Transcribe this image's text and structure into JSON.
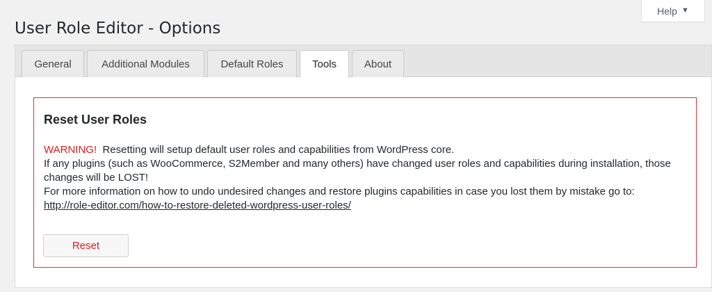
{
  "help_tab": {
    "label": "Help",
    "arrow": "▼",
    "arrow_icon": "triangle-down-icon"
  },
  "page": {
    "title": "User Role Editor - Options"
  },
  "tabs": [
    {
      "label": "General",
      "active": false
    },
    {
      "label": "Additional Modules",
      "active": false
    },
    {
      "label": "Default Roles",
      "active": false
    },
    {
      "label": "Tools",
      "active": true
    },
    {
      "label": "About",
      "active": false
    }
  ],
  "reset_section": {
    "title": "Reset User Roles",
    "warning": "WARNING!",
    "line1": "Resetting will setup default user roles and capabilities from WordPress core.",
    "line2": "If any plugins (such as WooCommerce, S2Member and many others) have changed user roles and capabilities during installation, those changes will be LOST!",
    "line3": "For more information on how to undo undesired changes and restore plugins capabilities in case you lost them by mistake go to:",
    "link": "http://role-editor.com/how-to-restore-deleted-wordpress-user-roles/",
    "button_label": "Reset"
  },
  "colors": {
    "warning": "#e01b1b",
    "box_border": "#e0303b",
    "background": "#f1f1f1"
  }
}
